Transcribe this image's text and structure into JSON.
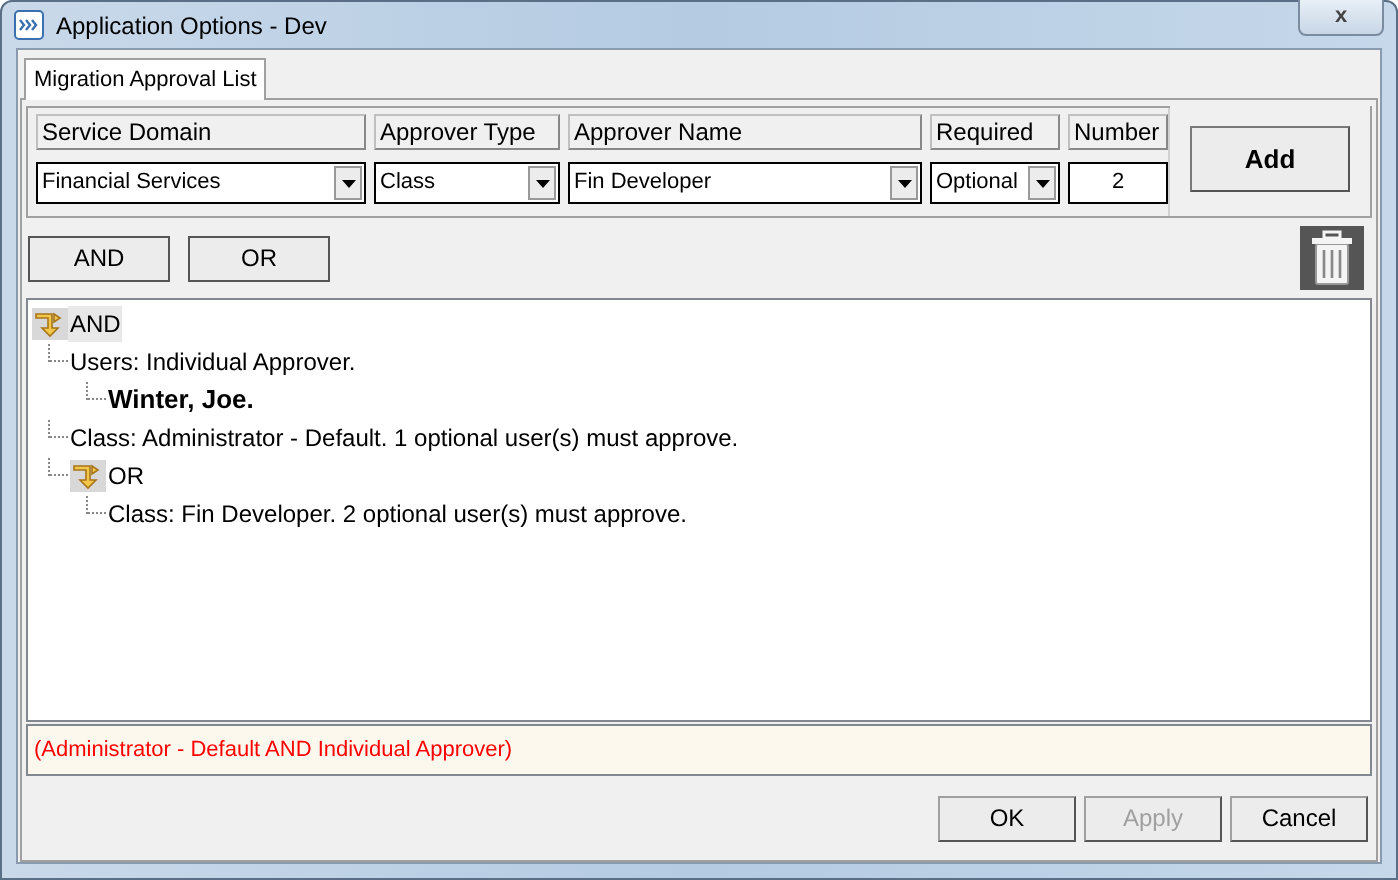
{
  "window": {
    "title": "Application Options - Dev",
    "close": "x"
  },
  "tabs": [
    {
      "label": "Migration Approval List",
      "selected": true
    }
  ],
  "form": {
    "columns": [
      {
        "header": "Service Domain",
        "kind": "dropdown",
        "value": "Financial Services"
      },
      {
        "header": "Approver Type",
        "kind": "dropdown",
        "value": "Class"
      },
      {
        "header": "Approver Name",
        "kind": "dropdown",
        "value": "Fin Developer"
      },
      {
        "header": "Required",
        "kind": "dropdown",
        "value": "Optional"
      },
      {
        "header": "Number",
        "kind": "number",
        "value": "2"
      }
    ],
    "add_button": "Add"
  },
  "operator_buttons": [
    "AND",
    "OR"
  ],
  "tree": [
    {
      "kind": "operator",
      "label": "AND",
      "children": [
        {
          "kind": "rule",
          "label": "Users: Individual Approver.",
          "children": [
            {
              "kind": "user",
              "label": "Winter, Joe."
            }
          ]
        },
        {
          "kind": "rule",
          "label": "Class: Administrator - Default. 1 optional user(s) must approve."
        },
        {
          "kind": "operator",
          "label": "OR",
          "children": [
            {
              "kind": "rule",
              "label": "Class: Fin Developer. 2 optional user(s) must approve."
            }
          ]
        }
      ]
    }
  ],
  "summary": "(Administrator - Default AND Individual Approver)",
  "buttons": [
    {
      "label": "OK",
      "disabled": false
    },
    {
      "label": "Apply",
      "disabled": true
    },
    {
      "label": "Cancel",
      "disabled": false
    }
  ]
}
